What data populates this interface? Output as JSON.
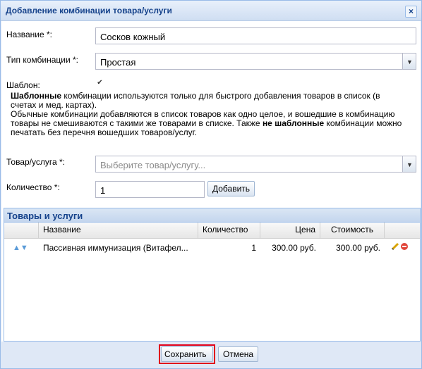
{
  "dialog": {
    "title": "Добавление комбинации товара/услуги",
    "close_glyph": "×"
  },
  "form": {
    "name_label": "Название *:",
    "name_value": "Сосков кожный",
    "type_label": "Тип комбинации *:",
    "type_value": "Простая",
    "template_label": "Шаблон:",
    "template_checked": true,
    "info": {
      "p1_bold": "Шаблонные",
      "p1_rest": " комбинации используются только для быстрого добавления товаров в список (в счетах и мед. картах).",
      "p2_start": "Обычные комбинации добавляются в список товаров как одно целое, и вошедшие в комбинацию товары не смешиваются с такими же товарами в списке. Также ",
      "p2_bold": "не шаблонные",
      "p2_end": " комбинации можно печатать без перечня вошедших товаров/услуг."
    },
    "product_label": "Товар/услуга *:",
    "product_placeholder": "Выберите товар/услугу...",
    "qty_label": "Количество *:",
    "qty_value": "1",
    "add_button": "Добавить"
  },
  "grid": {
    "title": "Товары и услуги",
    "columns": [
      "Название",
      "Количество",
      "Цена",
      "Стоимость"
    ],
    "rows": [
      {
        "name": "Пассивная иммунизация (Витафел...",
        "qty": "1",
        "price": "300.00 руб.",
        "cost": "300.00 руб."
      }
    ]
  },
  "footer": {
    "save": "Сохранить",
    "cancel": "Отмена"
  },
  "colors": {
    "title_text": "#15428b",
    "highlight": "#e0001b",
    "panel_bg": "#dfe8f6"
  }
}
